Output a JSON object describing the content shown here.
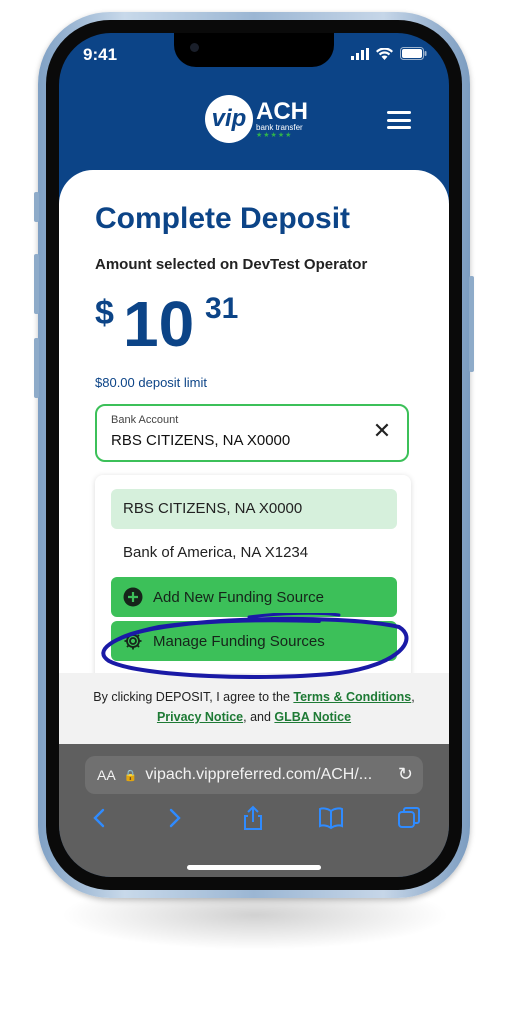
{
  "status": {
    "time": "9:41"
  },
  "brand": {
    "logo_mark": "vip",
    "logo_name": "ACH",
    "logo_sub": "bank transfer",
    "logo_stars": "★★★★★"
  },
  "page": {
    "title": "Complete Deposit",
    "subtitle": "Amount selected on DevTest Operator",
    "currency_symbol": "$",
    "amount_dollars": "10",
    "amount_cents": "31",
    "deposit_limit": "$80.00 deposit limit"
  },
  "bank_select": {
    "label": "Bank Account",
    "value": "RBS CITIZENS, NA X0000",
    "options": [
      "RBS CITIZENS, NA X0000",
      "Bank of America, NA X1234"
    ],
    "actions": [
      "Add New Funding Source",
      "Manage Funding Sources"
    ]
  },
  "terms": {
    "prefix": "By clicking DEPOSIT, I agree to the",
    "terms_link": "Terms & Conditions",
    "comma": ",",
    "privacy_link": "Privacy Notice",
    "and": ", and",
    "glba_link": "GLBA Notice"
  },
  "browser": {
    "aa": "AA",
    "url": "vipach.vippreferred.com/ACH/..."
  },
  "colors": {
    "brand_blue": "#0c4487",
    "accent_green": "#3cc059",
    "annotation": "#1a1aa6"
  },
  "icons": [
    "signal-icon",
    "wifi-icon",
    "battery-icon",
    "menu-icon",
    "close-icon",
    "plus-circle-icon",
    "gear-icon",
    "lock-icon",
    "reload-icon",
    "back-icon",
    "forward-icon",
    "share-icon",
    "bookmarks-icon",
    "tabs-icon"
  ]
}
